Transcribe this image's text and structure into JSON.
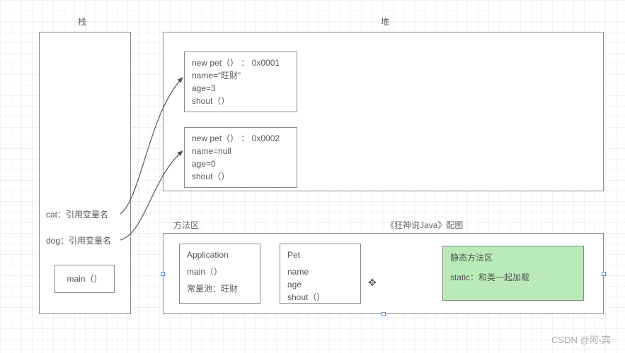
{
  "labels": {
    "stack": "栈",
    "heap": "堆",
    "method_area": "方法区",
    "caption": "《狂神说Java》配图"
  },
  "stack": {
    "cat": "cat：引用变量名",
    "dog": "dog：引用变量名",
    "main": "main（）"
  },
  "heap": {
    "obj1": {
      "line1": "new pet（） ： 0x0001",
      "line2": "name=“旺财”",
      "line3": "age=3",
      "line4": "shout（）"
    },
    "obj2": {
      "line1": "new pet（） ： 0x0002",
      "line2": "name=null",
      "line3": "age=0",
      "line4": "shout（）"
    }
  },
  "method_area": {
    "application": {
      "title": "Application",
      "line1": "main（）",
      "line2": "常量池：旺财"
    },
    "pet": {
      "title": "Pet",
      "line1": "name",
      "line2": "age",
      "line3": "shout（）"
    },
    "static": {
      "title": "静态方法区",
      "line1": "static：和类一起加载"
    }
  },
  "attribution": "CSDN @阿-宾"
}
